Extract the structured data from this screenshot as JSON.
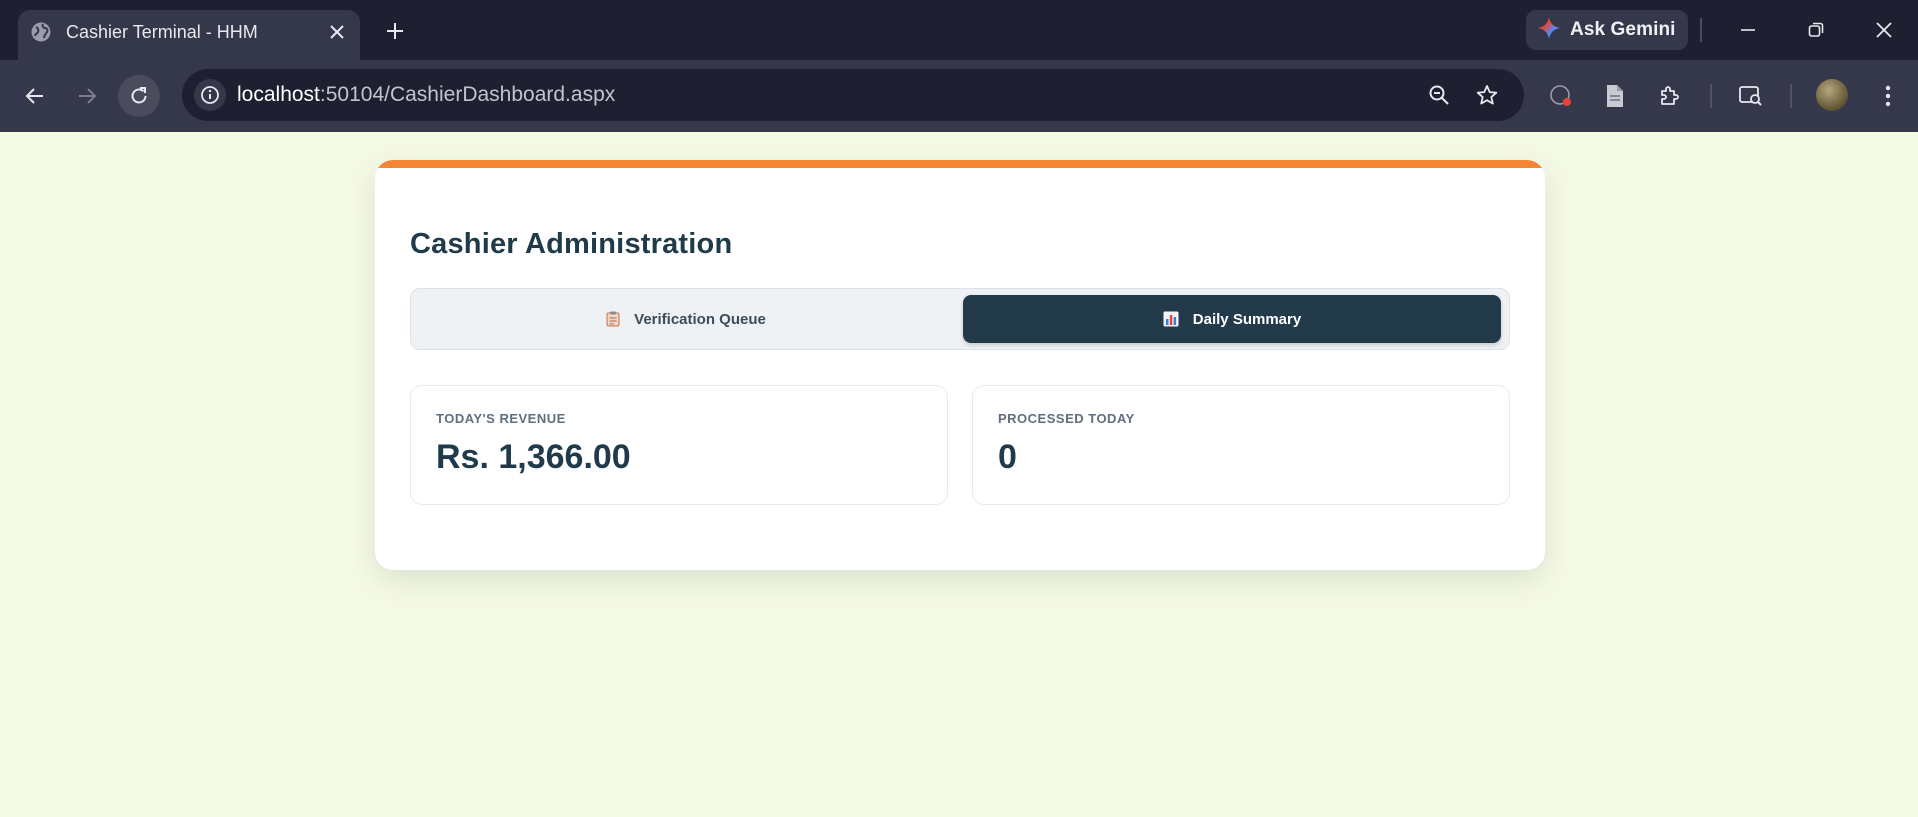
{
  "browser": {
    "tab_title": "Cashier Terminal - HHM",
    "url_host": "localhost",
    "url_path": ":50104/CashierDashboard.aspx",
    "gemini_label": "Ask Gemini"
  },
  "page": {
    "title": "Cashier Administration",
    "tabs": [
      {
        "label": "Verification Queue",
        "icon": "clipboard-icon",
        "active": false
      },
      {
        "label": "Daily Summary",
        "icon": "bar-chart-icon",
        "active": true
      }
    ],
    "stats": [
      {
        "label": "TODAY'S REVENUE",
        "value": "Rs. 1,366.00"
      },
      {
        "label": "PROCESSED TODAY",
        "value": "0"
      }
    ]
  },
  "colors": {
    "page_background": "#f5fae6",
    "accent": "#f58634",
    "primary_dark": "#233a4a",
    "title_text": "#1f3a4a"
  }
}
